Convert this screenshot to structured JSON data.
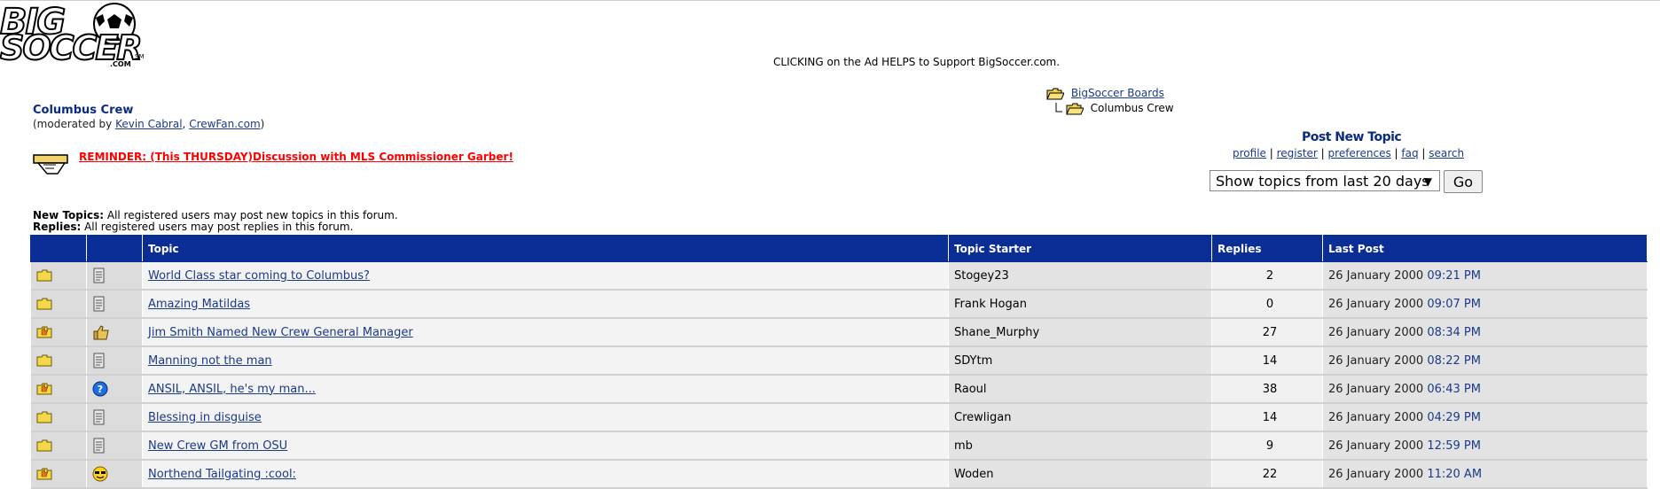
{
  "logo": {
    "line1": "BIG",
    "line2": "SOCCER",
    "com": ".COM",
    "sm": "SM"
  },
  "ad": {
    "text": "CLICKING on the Ad HELPS to Support BigSoccer.com."
  },
  "forum": {
    "title": "Columbus Crew",
    "moderated_prefix": "(moderated by ",
    "moderators": [
      "Kevin Cabral",
      "CrewFan.com"
    ],
    "moderated_sep": ", ",
    "moderated_suffix": ")"
  },
  "breadcrumb": {
    "root": "BigSoccer Boards",
    "current": "Columbus Crew"
  },
  "reminder": {
    "text": "REMINDER: (This THURSDAY)Discussion with MLS Commissioner Garber!"
  },
  "actions": {
    "post_new_topic": "Post New Topic",
    "links": [
      "profile",
      "register",
      "preferences",
      "faq",
      "search"
    ],
    "separator": " | "
  },
  "filter": {
    "selected": "Show topics from last 20 days",
    "go_label": "Go"
  },
  "permissions": {
    "new_topics_label": "New Topics:",
    "new_topics_text": " All registered users may post new topics in this forum.",
    "replies_label": "Replies:",
    "replies_text": " All registered users may post replies in this forum."
  },
  "table": {
    "headers": [
      "",
      "",
      "Topic",
      "Topic Starter",
      "Replies",
      "Last Post"
    ],
    "rows": [
      {
        "folder": "folder-icon",
        "post_icon": "post-icon",
        "topic": "World Class star coming to Columbus?",
        "starter": "Stogey23",
        "replies": "2",
        "date": "26 January 2000",
        "time": "09:21 PM"
      },
      {
        "folder": "folder-icon",
        "post_icon": "post-icon",
        "topic": "Amazing Matildas",
        "starter": "Frank Hogan",
        "replies": "0",
        "date": "26 January 2000",
        "time": "09:07 PM"
      },
      {
        "folder": "hot-folder-icon",
        "post_icon": "thumbs-up-icon",
        "topic": "Jim Smith Named New Crew General Manager",
        "starter": "Shane_Murphy",
        "replies": "27",
        "date": "26 January 2000",
        "time": "08:34 PM"
      },
      {
        "folder": "folder-icon",
        "post_icon": "post-icon",
        "topic": "Manning not the man",
        "starter": "SDYtm",
        "replies": "14",
        "date": "26 January 2000",
        "time": "08:22 PM"
      },
      {
        "folder": "hot-folder-icon",
        "post_icon": "question-icon",
        "topic": "ANSIL, ANSIL, he's my man...",
        "starter": "Raoul",
        "replies": "38",
        "date": "26 January 2000",
        "time": "06:43 PM"
      },
      {
        "folder": "folder-icon",
        "post_icon": "post-icon",
        "topic": "Blessing in disguise",
        "starter": "Crewligan",
        "replies": "14",
        "date": "26 January 2000",
        "time": "04:29 PM"
      },
      {
        "folder": "folder-icon",
        "post_icon": "post-icon",
        "topic": "New Crew GM from OSU",
        "starter": "mb",
        "replies": "9",
        "date": "26 January 2000",
        "time": "12:59 PM"
      },
      {
        "folder": "hot-folder-icon",
        "post_icon": "cool-smiley-icon",
        "topic": "Northend Tailgating :cool:",
        "starter": "Woden",
        "replies": "22",
        "date": "26 January 2000",
        "time": "11:20 AM"
      }
    ]
  }
}
